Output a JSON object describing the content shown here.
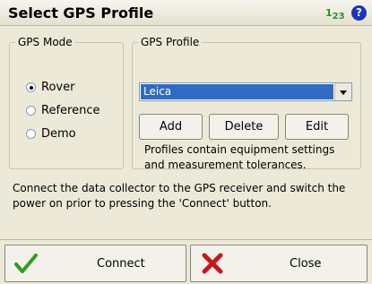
{
  "header": {
    "title": "Select GPS Profile",
    "input_mode_main": "1",
    "input_mode_sub": "23",
    "help_symbol": "?"
  },
  "gps_mode": {
    "legend": "GPS Mode",
    "options": [
      {
        "label": "Rover",
        "selected": true
      },
      {
        "label": "Reference",
        "selected": false
      },
      {
        "label": "Demo",
        "selected": false
      }
    ]
  },
  "gps_profile": {
    "legend": "GPS Profile",
    "selected": "Leica",
    "buttons": {
      "add": "Add",
      "delete": "Delete",
      "edit": "Edit"
    },
    "note": "Profiles contain equipment settings and measurement tolerances."
  },
  "instructions": "Connect the data collector to the GPS receiver and switch the power on prior to pressing the 'Connect' button.",
  "footer": {
    "connect_label": "Connect",
    "close_label": "Close"
  },
  "colors": {
    "selection": "#316ac5",
    "ok_check": "#2e9e1e",
    "close_x": "#c8161c",
    "help": "#1b35b8"
  }
}
